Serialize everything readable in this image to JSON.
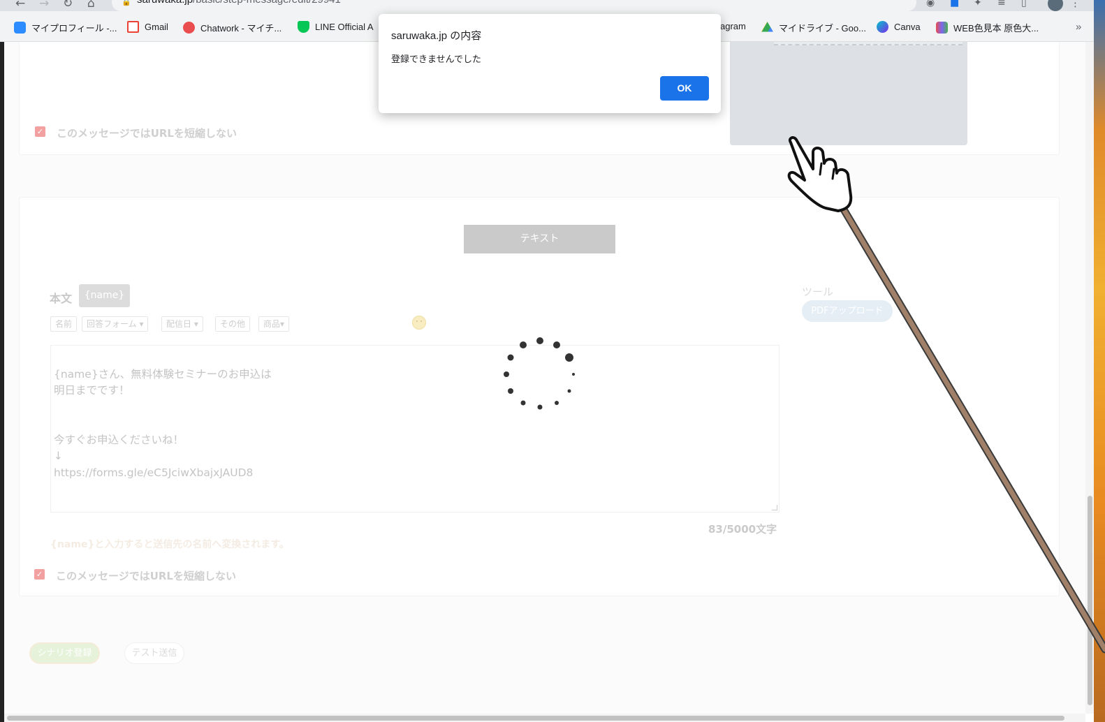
{
  "browser": {
    "url_host": "saruwaka.jp",
    "url_path": "/basic/step-message/edit/29941",
    "nav_back": "←",
    "nav_forward": "→",
    "nav_reload": "↻",
    "nav_home": "⌂",
    "more_bookmarks": "»",
    "menu": "⋮"
  },
  "bookmarks": [
    {
      "label": "マイプロフィール -...",
      "icon": "zoom-icon",
      "color": "#2d8cff"
    },
    {
      "label": "Gmail",
      "icon": "gmail-icon",
      "color": "#ea4335"
    },
    {
      "label": "Chatwork - マイチ...",
      "icon": "chatwork-icon",
      "color": "#e94d4d"
    },
    {
      "label": "LINE Official A",
      "icon": "line-icon",
      "color": "#06c755"
    },
    {
      "label": "agram",
      "icon": "instagram-icon",
      "color": ""
    },
    {
      "label": "マイドライブ - Goo...",
      "icon": "google-drive-icon",
      "color": "#fbbc04"
    },
    {
      "label": "Canva",
      "icon": "canva-icon",
      "color": "#00c4cc"
    },
    {
      "label": "WEB色見本 原色大...",
      "icon": "color-swatch-icon",
      "color": "#7b68ee"
    }
  ],
  "editor": {
    "checkbox_label_top": "このメッセージではURLを短縮しない",
    "checkbox_label_bottom": "このメッセージではURLを短縮しない",
    "type_button": "テキスト",
    "body_label": "本文",
    "name_chip": "{name}",
    "toolbar": [
      "名前",
      "回答フォーム ▾",
      "配信日 ▾",
      "その他",
      "商品▾"
    ],
    "text_body": "{name}さん、無料体験セミナーのお申込は\n明日までです！\n\n\n今すぐお申込くださいね！\n↓\nhttps://forms.gle/eC5JciwXbajxJAUD8",
    "char_counter": "83/5000文字",
    "hint": "{name}と入力すると送信先の名前へ変換されます。",
    "tools_label": "ツール",
    "pdf_upload": "PDFアップロード",
    "register_button": "シナリオ登録",
    "test_send_button": "テスト送信"
  },
  "dialog": {
    "title": "saruwaka.jp の内容",
    "message": "登録できませんでした",
    "ok": "OK"
  },
  "colors": {
    "dialog_ok": "#1a73e8",
    "checkbox": "#f2a0a0",
    "type_button": "#cacaca"
  }
}
